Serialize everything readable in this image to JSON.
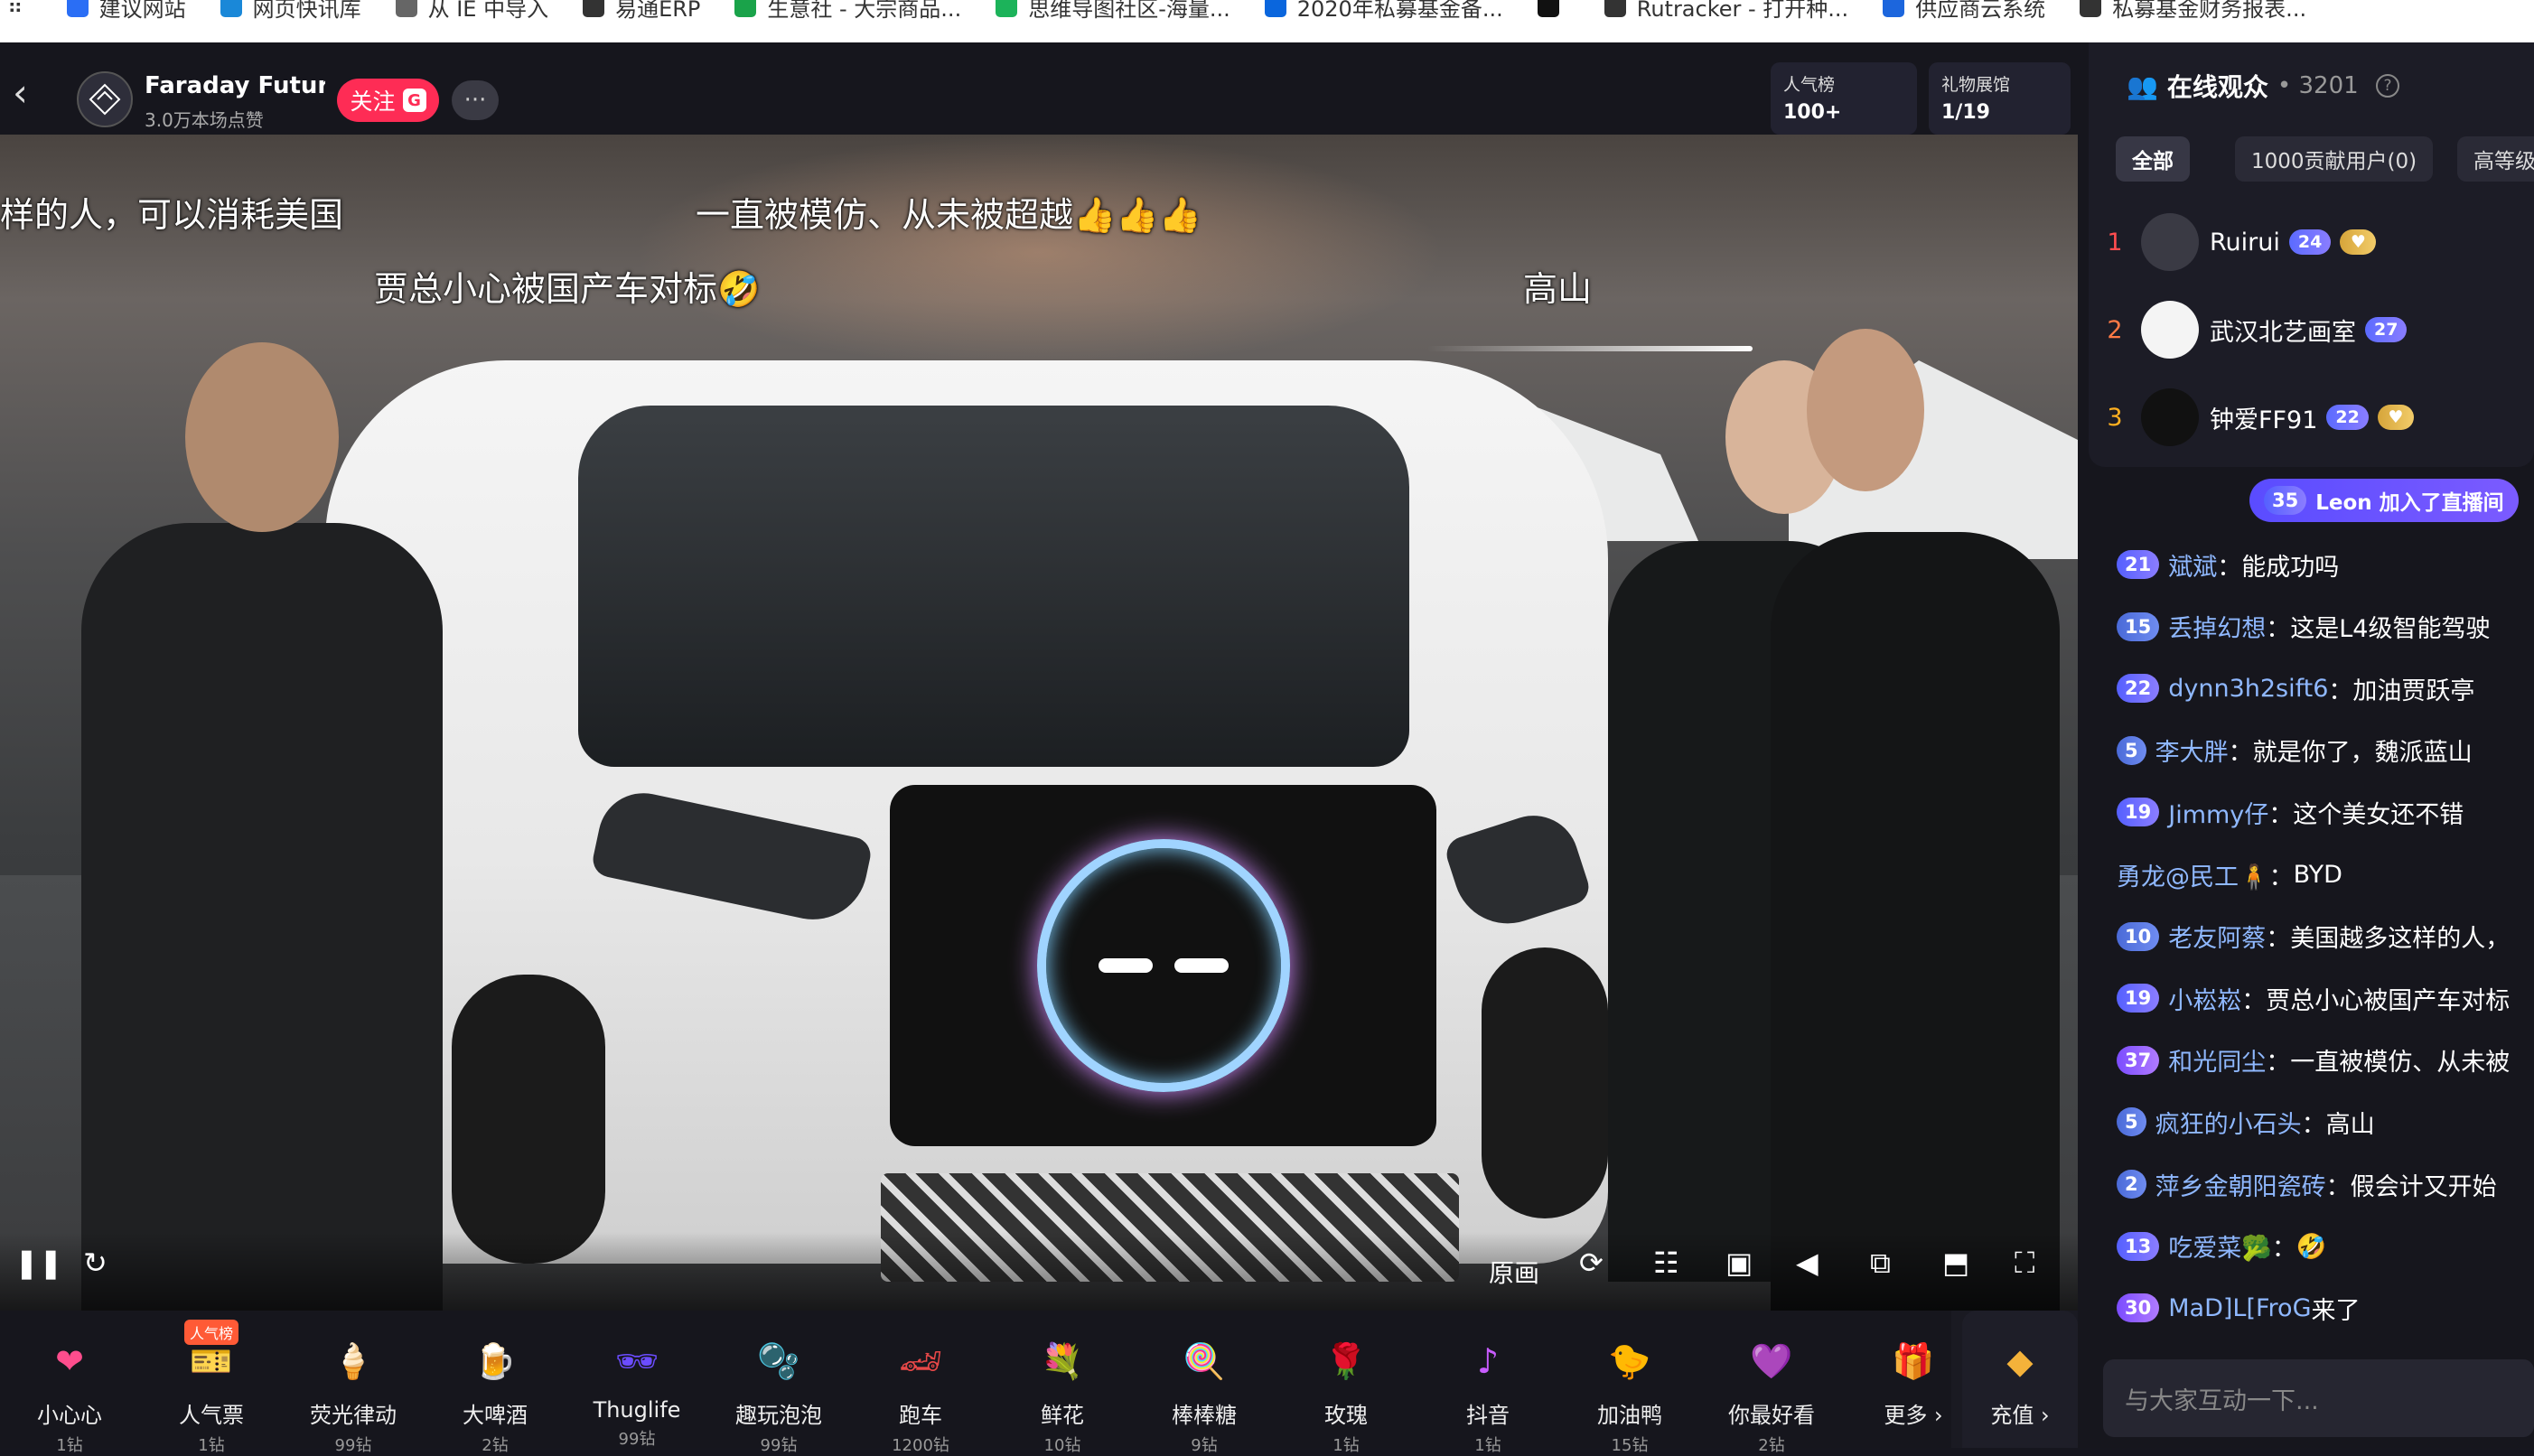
{
  "bookmarks": [
    {
      "label": "建议网站",
      "icon": "globe-icon",
      "color": "#2a6ef5"
    },
    {
      "label": "网页快讯库",
      "icon": "edge-icon",
      "color": "#1a88d8"
    },
    {
      "label": "从 IE 中导入",
      "icon": "folder-icon",
      "color": "#666666"
    },
    {
      "label": "易通ERP",
      "icon": "globe-icon",
      "color": "#333333"
    },
    {
      "label": "生意社 - 大宗商品...",
      "icon": "shop-icon",
      "color": "#1aa34a"
    },
    {
      "label": "思维导图社区-海量...",
      "icon": "map-icon",
      "color": "#1cb35a"
    },
    {
      "label": "2020年私募基金备...",
      "icon": "zhihu-icon",
      "color": "#0a66dd"
    },
    {
      "label": "",
      "icon": "tiktok-icon",
      "color": "#111111"
    },
    {
      "label": "Rutracker - 打开种...",
      "icon": "globe-icon",
      "color": "#333333"
    },
    {
      "label": "供应商云系统",
      "icon": "doc-icon",
      "color": "#1c66dd"
    },
    {
      "label": "私募基金财务报表...",
      "icon": "globe-icon",
      "color": "#333333"
    }
  ],
  "header": {
    "back_icon": "chevron-left-icon",
    "anchor_name": "Faraday Future…",
    "anchor_likes": "3.0万本场点赞",
    "follow_label": "关注",
    "follow_badge": "G",
    "more_label": "···",
    "rank_title": "人气榜",
    "rank_value": "100+",
    "gift_hall_title": "礼物展馆",
    "gift_hall_value": "1/19"
  },
  "danmaku": [
    {
      "text": "样的人，可以消耗美国"
    },
    {
      "text": "一直被模仿、从未被超越👍👍👍"
    },
    {
      "text": "贾总小心被国产车对标🤣"
    },
    {
      "text": "高山"
    }
  ],
  "controls": {
    "quality_label": "原画"
  },
  "gifts": [
    {
      "name": "小心心",
      "price": "1钻",
      "icon": "heart-icon",
      "color": "#ff4d8d",
      "glyph": "❤"
    },
    {
      "name": "人气票",
      "price": "1钻",
      "icon": "ticket-icon",
      "color": "#ff6a3d",
      "glyph": "🎫",
      "tag": "人气榜"
    },
    {
      "name": "荧光律动",
      "price": "99钻",
      "icon": "popsicle-icon",
      "color": "#4ab8ff",
      "glyph": "🍦"
    },
    {
      "name": "大啤酒",
      "price": "2钻",
      "icon": "beer-icon",
      "color": "#f4b23a",
      "glyph": "🍺"
    },
    {
      "name": "Thuglife",
      "price": "99钻",
      "icon": "sunglasses-icon",
      "color": "#6b4cff",
      "glyph": "🕶"
    },
    {
      "name": "趣玩泡泡",
      "price": "99钻",
      "icon": "bubble-icon",
      "color": "#66a8ff",
      "glyph": "🫧"
    },
    {
      "name": "跑车",
      "price": "1200钻",
      "icon": "car-icon",
      "color": "#e84848",
      "glyph": "🏎"
    },
    {
      "name": "鲜花",
      "price": "10钻",
      "icon": "flower-icon",
      "color": "#ff4f7a",
      "glyph": "💐"
    },
    {
      "name": "棒棒糖",
      "price": "9钻",
      "icon": "lollipop-icon",
      "color": "#ff73b5",
      "glyph": "🍭"
    },
    {
      "name": "玫瑰",
      "price": "1钻",
      "icon": "rose-icon",
      "color": "#e8283c",
      "glyph": "🌹"
    },
    {
      "name": "抖音",
      "price": "1钻",
      "icon": "tiktok-icon",
      "color": "#c85cff",
      "glyph": "♪"
    },
    {
      "name": "加油鸭",
      "price": "15钻",
      "icon": "duck-icon",
      "color": "#ffc83a",
      "glyph": "🐤"
    },
    {
      "name": "你最好看",
      "price": "2钻",
      "icon": "heart-badge-icon",
      "color": "#a24cff",
      "glyph": "💜"
    },
    {
      "name": "更多",
      "price": "",
      "icon": "gift-box-icon",
      "color": "#ff3d6b",
      "glyph": "🎁"
    }
  ],
  "recharge": {
    "label": "充值",
    "icon": "diamond-icon"
  },
  "audience": {
    "title": "在线观众",
    "count": "3201",
    "tabs": [
      "全部",
      "1000贡献用户(0)",
      "高等级用"
    ],
    "top": [
      {
        "rank": "1",
        "name": "Ruirui",
        "level": "24",
        "rank_color": "#ff4d4f",
        "avatar_color": "#3a3a44"
      },
      {
        "rank": "2",
        "name": "武汉北艺画室",
        "level": "27",
        "rank_color": "#ff7a45",
        "avatar_color": "#f4f4f4"
      },
      {
        "rank": "3",
        "name": "钟爱FF91",
        "level": "22",
        "rank_color": "#ffb020",
        "avatar_color": "#111111"
      }
    ]
  },
  "join_notice": {
    "level": "35",
    "text": "Leon 加入了直播间"
  },
  "chat": [
    {
      "level": "21",
      "user": "斌斌",
      "text": "能成功吗"
    },
    {
      "level": "15",
      "user": "丢掉幻想",
      "text": "这是L4级智能驾驶"
    },
    {
      "level": "22",
      "user": "dynn3h2sift6",
      "text": "加油贾跃亭"
    },
    {
      "level": "5",
      "user": "李大胖",
      "text": "就是你了，魏派蓝山"
    },
    {
      "level": "19",
      "user": "Jimmy仔",
      "text": "这个美女还不错"
    },
    {
      "level": "",
      "user": "勇龙@民工🧍",
      "text": "BYD"
    },
    {
      "level": "10",
      "user": "老友阿蔡",
      "text": "美国越多这样的人，"
    },
    {
      "level": "19",
      "user": "小崧崧",
      "text": "贾总小心被国产车对标"
    },
    {
      "level": "37",
      "user": "和光同尘",
      "text": "一直被模仿、从未被"
    },
    {
      "level": "5",
      "user": "疯狂的小石头",
      "text": "高山"
    },
    {
      "level": "2",
      "user": "萍乡金朝阳瓷砖",
      "text": "假会计又开始"
    },
    {
      "level": "13",
      "user": "吃爱菜🥦",
      "text": "🤣"
    },
    {
      "level": "30",
      "user": "MaD]L[FroG",
      "text": "来了"
    }
  ],
  "input_placeholder": "与大家互动一下..."
}
